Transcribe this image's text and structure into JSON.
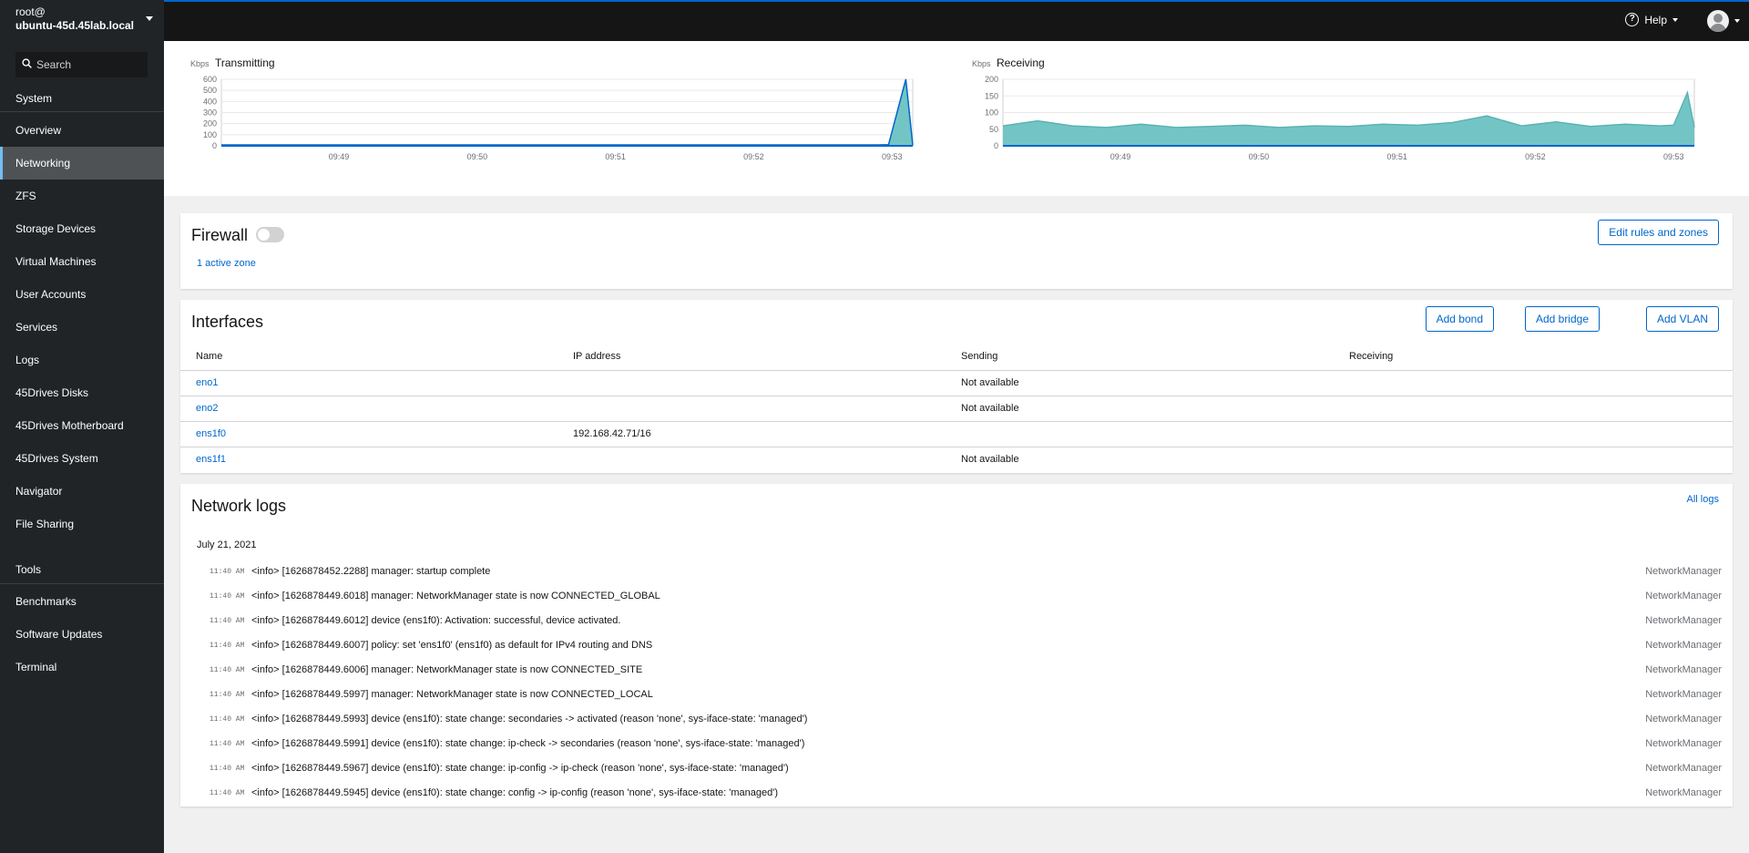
{
  "host": {
    "user": "root@",
    "hostname": "ubuntu-45d.45lab.local"
  },
  "search": {
    "placeholder": "Search"
  },
  "nav": {
    "system_heading": "System",
    "items": [
      "Overview",
      "Networking",
      "ZFS",
      "Storage Devices",
      "Virtual Machines",
      "User Accounts",
      "Services",
      "Logs",
      "45Drives Disks",
      "45Drives Motherboard",
      "45Drives System",
      "Navigator",
      "File Sharing"
    ],
    "active": "Networking",
    "tools_heading": "Tools",
    "tools": [
      "Benchmarks",
      "Software Updates",
      "Terminal"
    ]
  },
  "topbar": {
    "help_label": "Help"
  },
  "chart_data": [
    {
      "type": "line",
      "title": "Transmitting",
      "ylabel": "Kbps",
      "yticks": [
        0,
        100,
        200,
        300,
        400,
        500,
        600
      ],
      "ylim": [
        0,
        600
      ],
      "xticks": [
        "09:49",
        "09:50",
        "09:51",
        "09:52",
        "09:53"
      ],
      "x": [
        0,
        0.2,
        0.4,
        0.6,
        0.8,
        0.9,
        0.95,
        0.965,
        0.99,
        1
      ],
      "values": [
        8,
        8,
        8,
        8,
        8,
        8,
        8,
        10,
        600,
        5
      ],
      "color": "#0066cc"
    },
    {
      "type": "area",
      "title": "Receiving",
      "ylabel": "Kbps",
      "yticks": [
        0,
        50,
        100,
        150,
        200
      ],
      "ylim": [
        0,
        200
      ],
      "xticks": [
        "09:49",
        "09:50",
        "09:51",
        "09:52",
        "09:53"
      ],
      "x": [
        0,
        0.05,
        0.1,
        0.15,
        0.2,
        0.25,
        0.3,
        0.35,
        0.4,
        0.45,
        0.5,
        0.55,
        0.6,
        0.65,
        0.7,
        0.75,
        0.8,
        0.85,
        0.9,
        0.95,
        0.97,
        0.99,
        1
      ],
      "values": [
        60,
        75,
        60,
        55,
        65,
        55,
        58,
        62,
        55,
        60,
        58,
        65,
        62,
        70,
        90,
        60,
        72,
        58,
        65,
        60,
        62,
        160,
        55
      ],
      "color": "#73c5c5"
    }
  ],
  "firewall": {
    "title": "Firewall",
    "enabled": false,
    "zones_link": "1 active zone",
    "edit_button": "Edit rules and zones"
  },
  "interfaces": {
    "title": "Interfaces",
    "buttons": {
      "add_bond": "Add bond",
      "add_bridge": "Add bridge",
      "add_vlan": "Add VLAN"
    },
    "columns": [
      "Name",
      "IP address",
      "Sending",
      "Receiving"
    ],
    "rows": [
      {
        "name": "eno1",
        "ip": "",
        "sending": "Not available",
        "receiving": ""
      },
      {
        "name": "eno2",
        "ip": "",
        "sending": "Not available",
        "receiving": ""
      },
      {
        "name": "ens1f0",
        "ip": "192.168.42.71/16",
        "sending": "",
        "receiving": ""
      },
      {
        "name": "ens1f1",
        "ip": "",
        "sending": "Not available",
        "receiving": ""
      }
    ]
  },
  "logs": {
    "title": "Network logs",
    "all_logs_link": "All logs",
    "date": "July 21, 2021",
    "entries": [
      {
        "time": "11:40 AM",
        "message": "<info> [1626878452.2288] manager: startup complete",
        "source": "NetworkManager"
      },
      {
        "time": "11:40 AM",
        "message": "<info> [1626878449.6018] manager: NetworkManager state is now CONNECTED_GLOBAL",
        "source": "NetworkManager"
      },
      {
        "time": "11:40 AM",
        "message": "<info> [1626878449.6012] device (ens1f0): Activation: successful, device activated.",
        "source": "NetworkManager"
      },
      {
        "time": "11:40 AM",
        "message": "<info> [1626878449.6007] policy: set 'ens1f0' (ens1f0) as default for IPv4 routing and DNS",
        "source": "NetworkManager"
      },
      {
        "time": "11:40 AM",
        "message": "<info> [1626878449.6006] manager: NetworkManager state is now CONNECTED_SITE",
        "source": "NetworkManager"
      },
      {
        "time": "11:40 AM",
        "message": "<info> [1626878449.5997] manager: NetworkManager state is now CONNECTED_LOCAL",
        "source": "NetworkManager"
      },
      {
        "time": "11:40 AM",
        "message": "<info> [1626878449.5993] device (ens1f0): state change: secondaries -> activated (reason 'none', sys-iface-state: 'managed')",
        "source": "NetworkManager"
      },
      {
        "time": "11:40 AM",
        "message": "<info> [1626878449.5991] device (ens1f0): state change: ip-check -> secondaries (reason 'none', sys-iface-state: 'managed')",
        "source": "NetworkManager"
      },
      {
        "time": "11:40 AM",
        "message": "<info> [1626878449.5967] device (ens1f0): state change: ip-config -> ip-check (reason 'none', sys-iface-state: 'managed')",
        "source": "NetworkManager"
      },
      {
        "time": "11:40 AM",
        "message": "<info> [1626878449.5945] device (ens1f0): state change: config -> ip-config (reason 'none', sys-iface-state: 'managed')",
        "source": "NetworkManager"
      }
    ]
  }
}
